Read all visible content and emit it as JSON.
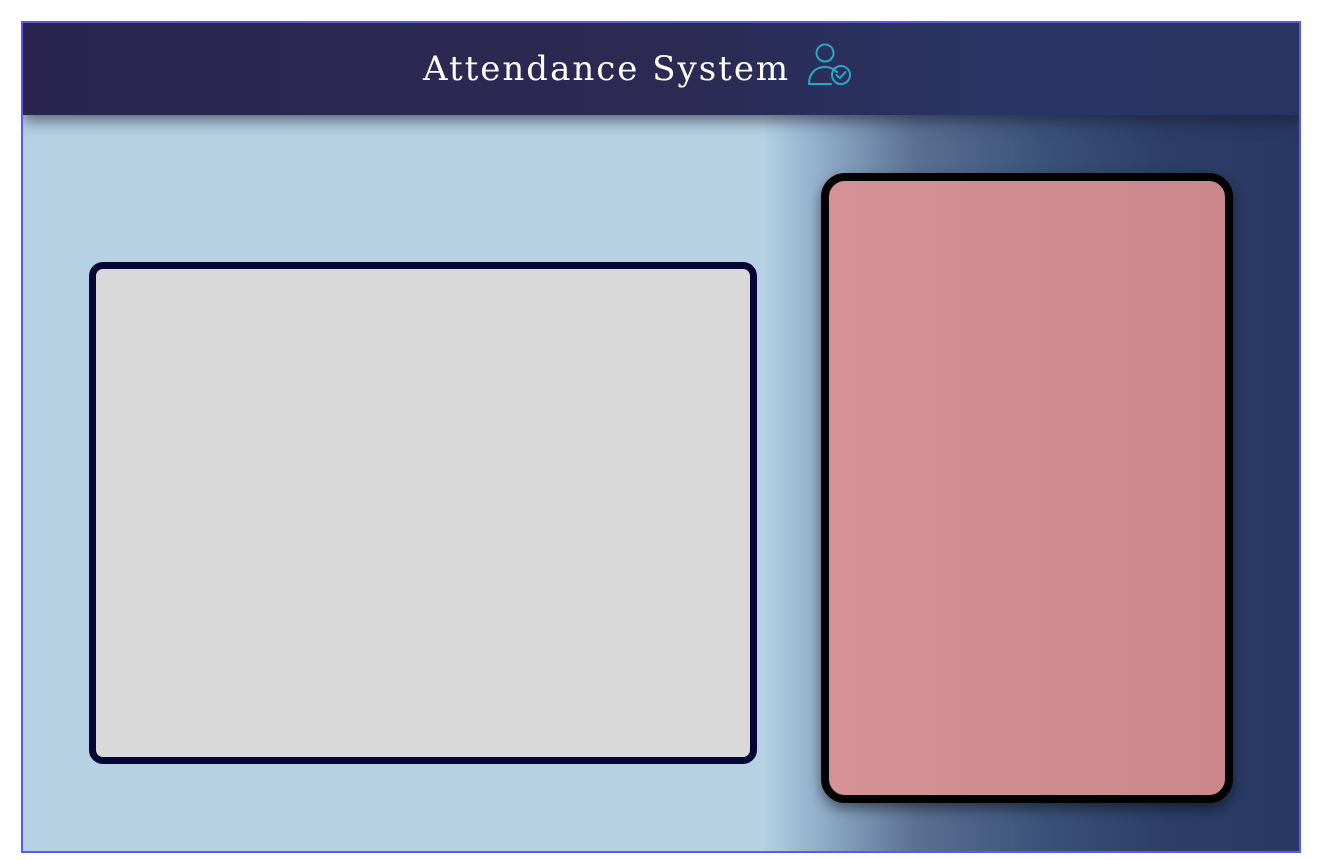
{
  "header": {
    "title": "Attendance System",
    "icon": "user-check-icon"
  },
  "panels": {
    "camera_panel": {
      "content": ""
    },
    "info_panel": {
      "content": ""
    }
  },
  "colors": {
    "header_bg": "#2a2550",
    "background_light": "#b5d1e3",
    "background_dark": "#283863",
    "camera_panel_bg": "#d9d9d9",
    "camera_panel_border": "#060634",
    "info_panel_bg": "#d08e92",
    "info_panel_border": "#000000",
    "icon_color": "#2aa6c8",
    "frame_border": "#5a5ae6"
  }
}
